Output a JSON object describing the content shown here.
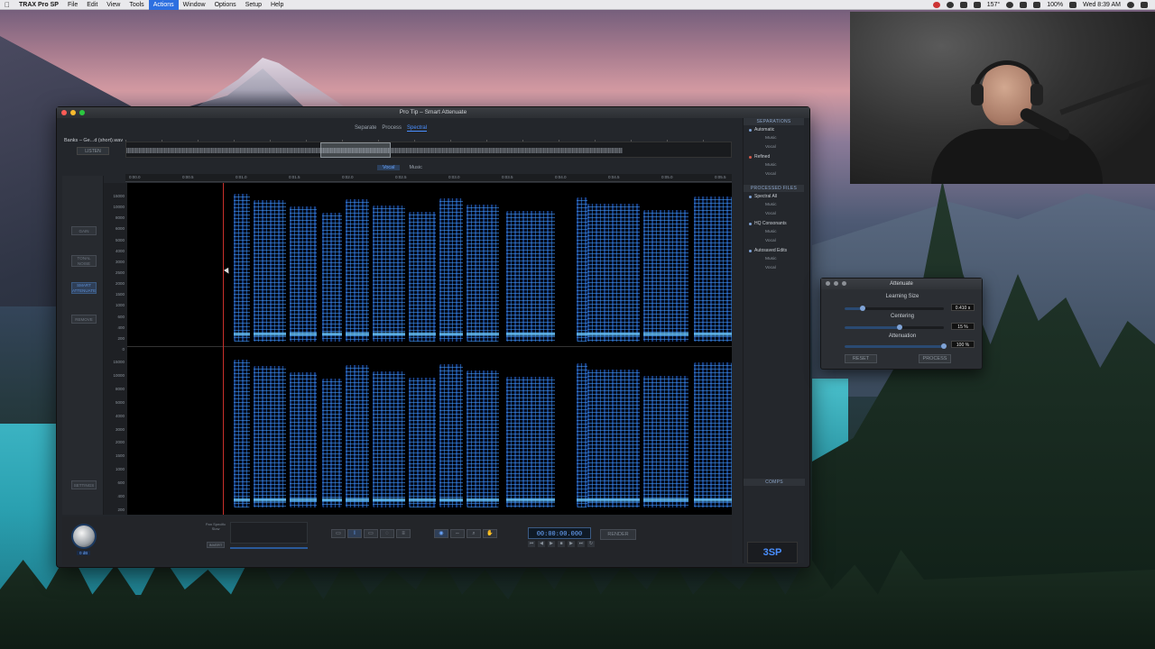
{
  "menubar": {
    "app_name": "TRAX Pro SP",
    "items": [
      "File",
      "Edit",
      "View",
      "Tools",
      "Actions",
      "Window",
      "Options",
      "Setup",
      "Help"
    ],
    "active_item": "Actions",
    "battery": "100%",
    "clock": "Wed 8:39 AM",
    "audio_level": "157°"
  },
  "window": {
    "title": "Pro Tip – Smart Attenuate",
    "modes": [
      "Separate",
      "Process",
      "Spectral"
    ],
    "active_mode": "Spectral",
    "file_name": "Banks – Ge...d (short).wav",
    "listen_label": "LISTEN",
    "layer_tabs": [
      "Vocal",
      "Music"
    ],
    "active_layer": "Vocal",
    "left_buttons": {
      "gain": "GAIN",
      "smart_attenuate": "SMART ATTENUATE",
      "harmonic": "TONAL NOISE",
      "remove": "REMOVE",
      "settings": "SETTINGS"
    },
    "freq_labels_top": [
      "15000",
      "10000",
      "8000",
      "6000",
      "5000",
      "4000",
      "3000",
      "2500",
      "2000",
      "1500",
      "1000",
      "600",
      "400",
      "200",
      "0"
    ],
    "freq_labels_bot": [
      "15000",
      "10000",
      "8000",
      "5000",
      "4000",
      "3000",
      "2000",
      "1500",
      "1000",
      "600",
      "400",
      "200"
    ],
    "timeline_ticks": [
      "0:00.0",
      "0:00.5",
      "0:01.0",
      "0:01.5",
      "0:02.0",
      "0:02.5",
      "0:03.0",
      "0:03.5",
      "0:04.0",
      "0:04.5",
      "0:05.0",
      "0:05.5"
    ]
  },
  "right_panel": {
    "separations_header": "SEPARATIONS",
    "separations": [
      {
        "name": "Automatic",
        "color": "#7fa3d6",
        "children": [
          "Music",
          "Vocal"
        ]
      },
      {
        "name": "Refined",
        "color": "#d35a4a",
        "children": [
          "Music",
          "Vocal"
        ]
      }
    ],
    "processed_header": "PROCESSED FILES",
    "processed": [
      {
        "name": "Spectral All",
        "children": [
          "Music",
          "Vocal"
        ]
      },
      {
        "name": "HQ Consonants",
        "children": [
          "Music",
          "Vocal"
        ]
      },
      {
        "name": "Autosaved Edits",
        "children": [
          "Music",
          "Vocal"
        ]
      }
    ],
    "comps_header": "COMPS",
    "logo": "3SP"
  },
  "bottom_bar": {
    "knob_label": "0 dB",
    "pan_label": "Pan Specific Slow",
    "invert_label": "INVERT",
    "time": "00:00:00.000",
    "render_label": "RENDER"
  },
  "attenuate": {
    "title": "Attenuate",
    "learning_size_label": "Learning Size",
    "learning_size_value": "0.410 s",
    "learning_size_level": 0.18,
    "centering_label": "Centering",
    "centering_value": "15 %",
    "centering_level": 0.55,
    "attenuation_label": "Attenuation",
    "attenuation_value": "100 %",
    "attenuation_level": 1.0,
    "reset_label": "RESET",
    "process_label": "PROCESS"
  },
  "colors": {
    "accent": "#4a8fff",
    "playhead": "#c8302a"
  }
}
